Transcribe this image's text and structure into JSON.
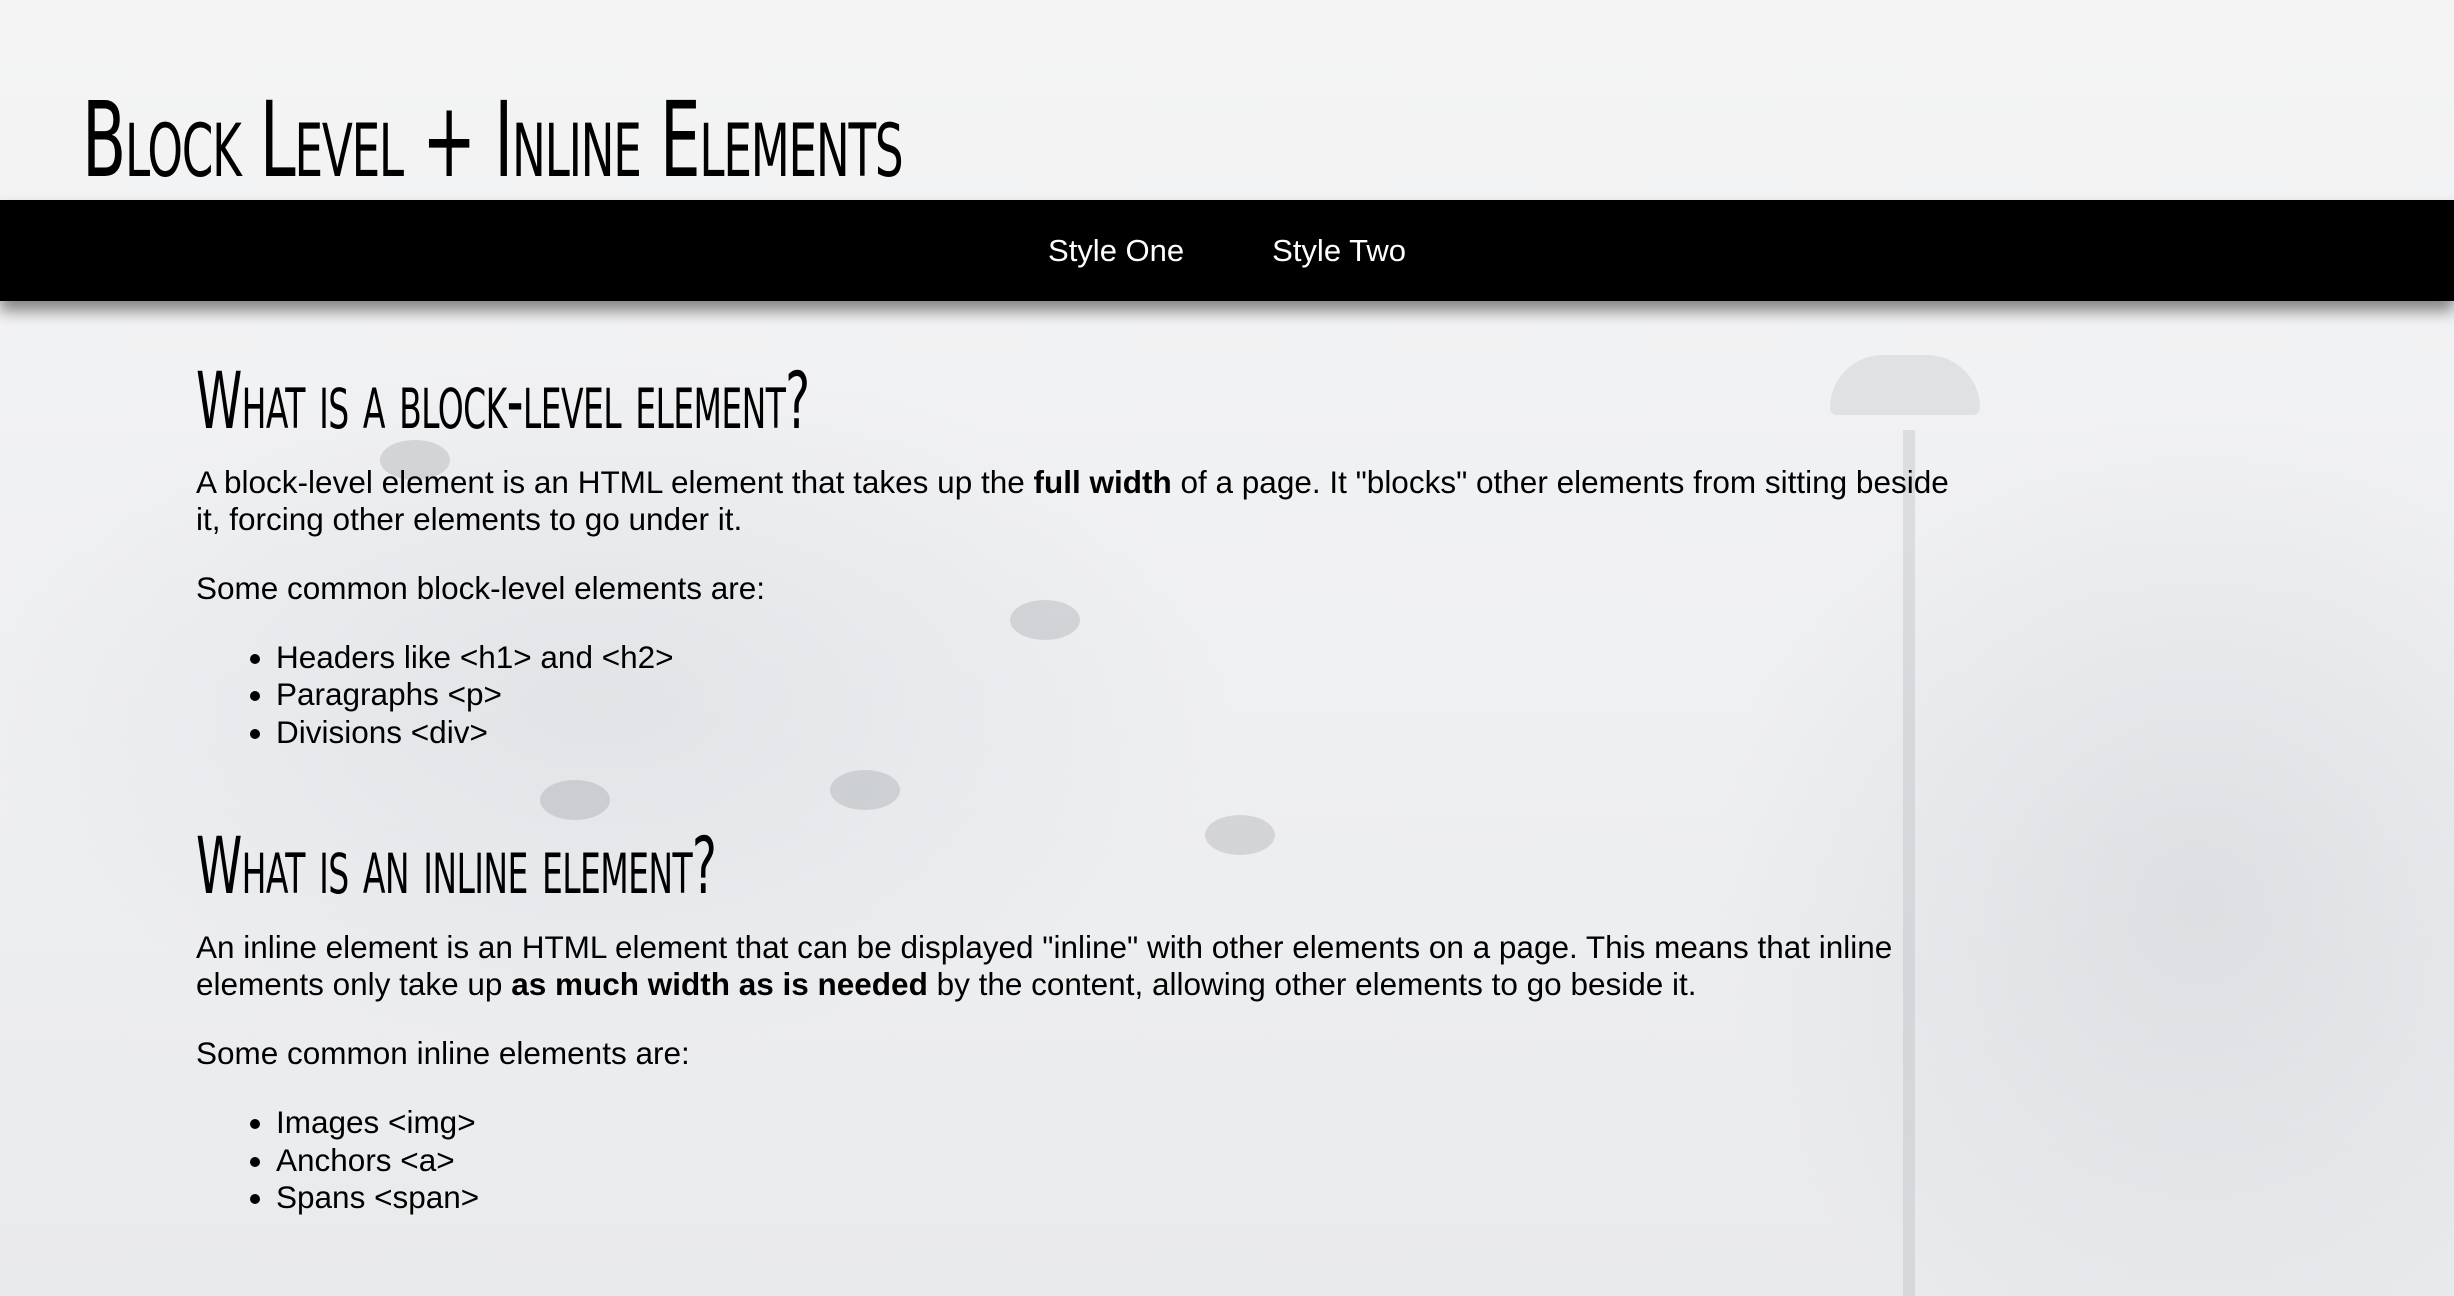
{
  "header": {
    "title": "Block Level + Inline Elements"
  },
  "nav": {
    "items": [
      {
        "label": "Style One"
      },
      {
        "label": "Style Two"
      }
    ]
  },
  "sections": [
    {
      "heading": "What is a block-level element?",
      "intro": {
        "before": "A block-level element is an HTML element that takes up the ",
        "bold": "full width",
        "after": " of a page. It \"blocks\" other elements from sitting beside it, forcing other elements to go under it."
      },
      "list_intro": "Some common block-level elements are:",
      "list": [
        "Headers like <h1> and <h2>",
        "Paragraphs <p>",
        "Divisions <div>"
      ]
    },
    {
      "heading": "What is an inline element?",
      "intro": {
        "before": "An inline element is an HTML element that can be displayed \"inline\" with other elements on a page. This means that inline elements only take up ",
        "bold": "as much width as is needed",
        "after": " by the content, allowing other elements to go beside it."
      },
      "list_intro": "Some common inline elements are:",
      "list": [
        "Images <img>",
        "Anchors <a>",
        "Spans <span>"
      ]
    }
  ]
}
